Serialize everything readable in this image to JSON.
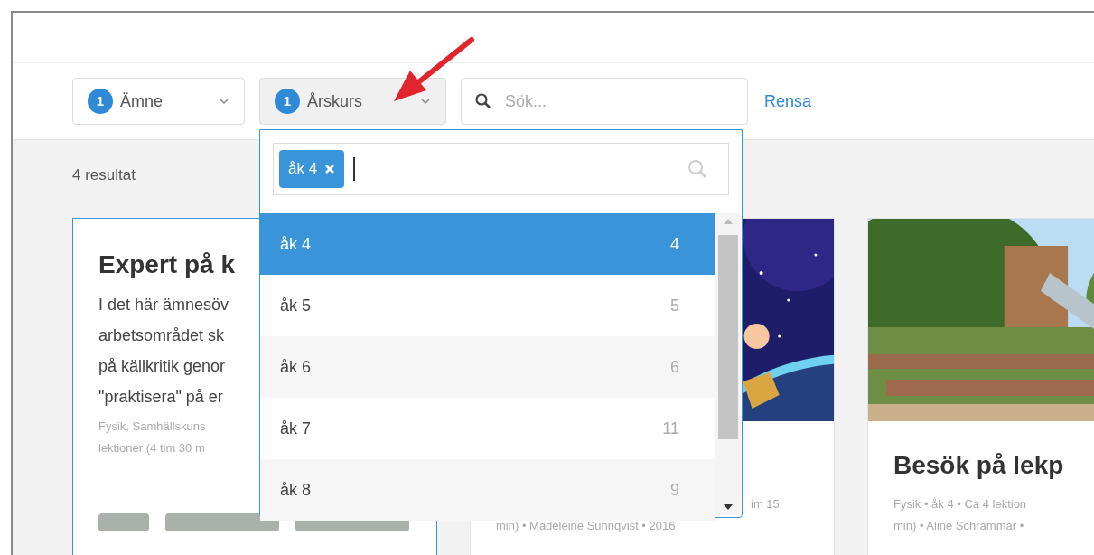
{
  "filters": [
    {
      "count": "1",
      "label": "Ämne",
      "expanded": false
    },
    {
      "count": "1",
      "label": "Årskurs",
      "expanded": true
    }
  ],
  "search": {
    "placeholder": "Sök..."
  },
  "clear_link": "Rensa",
  "result_count": "4 resultat",
  "dropdown": {
    "chips": [
      {
        "label": "åk 4"
      }
    ],
    "options": [
      {
        "label": "åk 4",
        "count": "4",
        "selected": true
      },
      {
        "label": "åk 5",
        "count": "5",
        "selected": false
      },
      {
        "label": "åk 6",
        "count": "6",
        "selected": false
      },
      {
        "label": "åk 7",
        "count": "11",
        "selected": false
      },
      {
        "label": "åk 8",
        "count": "9",
        "selected": false
      }
    ]
  },
  "cards": [
    {
      "kind": "text",
      "highlighted": true,
      "title": "Expert på k",
      "description_lines": [
        "I det här ämnesöv",
        "arbetsområdet sk",
        "på källkritik genor",
        "\"praktisera\" på er"
      ],
      "meta_lines": [
        "Fysik, Samhällskuns",
        "lektioner (4 tim 30 m"
      ]
    },
    {
      "kind": "picture",
      "highlighted": false,
      "meta_lines": [
        "im 15",
        "min) • Madeleine Sunnqvist • 2016"
      ]
    },
    {
      "kind": "picture",
      "highlighted": false,
      "title": "Besök på lekp",
      "meta_lines": [
        "Fysik • åk 4 • Ca 4 lektion",
        "min) • Aline Schrammar •"
      ]
    }
  ]
}
